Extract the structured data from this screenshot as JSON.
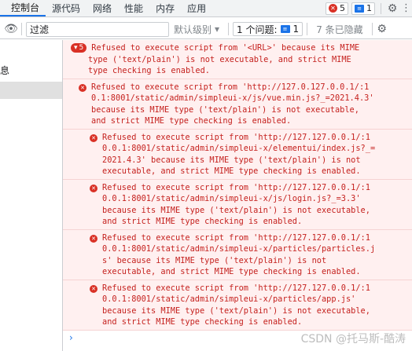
{
  "tabs": [
    "控制台",
    "源代码",
    "网络",
    "性能",
    "内存",
    "应用"
  ],
  "tools": {
    "error_count": "5",
    "message_count": "1"
  },
  "toolbar": {
    "filter_value": "过滤",
    "levels_label": "默认级别",
    "issues_label": "1 个问题:",
    "issues_count": "1",
    "hidden_label": "7 条已隐藏"
  },
  "sidebar": {
    "label": "息"
  },
  "console": {
    "group_count": "5",
    "head_lines": [
      "Refused to execute script from '<URL>' because its MIME",
      "type ('text/plain') is not executable, and strict MIME",
      "type checking is enabled."
    ],
    "first": [
      "Refused to execute script from 'http://127.0.127.0.0.1/:1",
      "0.1:8001/static/admin/simpleui-x/js/vue.min.js?_=2021.4.3'",
      "because its MIME type ('text/plain') is not executable,",
      "and strict MIME type checking is enabled."
    ],
    "items": [
      [
        "Refused to execute script from 'http://127.127.0.0.1/:1",
        "0.0.1:8001/static/admin/simpleui-x/elementui/index.js?_=",
        "2021.4.3' because its MIME type ('text/plain') is not",
        "executable, and strict MIME type checking is enabled."
      ],
      [
        "Refused to execute script from 'http://127.127.0.0.1/:1",
        "0.0.1:8001/static/admin/simpleui-x/js/login.js?_=3.3'",
        "because its MIME type ('text/plain') is not executable,",
        "and strict MIME type checking is enabled."
      ],
      [
        "Refused to execute script from 'http://127.127.0.0.1/:1",
        "0.0.1:8001/static/admin/simpleui-x/particles/particles.j",
        "s' because its MIME type ('text/plain') is not",
        "executable, and strict MIME type checking is enabled."
      ],
      [
        "Refused to execute script from 'http://127.127.0.0.1/:1",
        "0.0.1:8001/static/admin/simpleui-x/particles/app.js'",
        "because its MIME type ('text/plain') is not executable,",
        "and strict MIME type checking is enabled."
      ]
    ],
    "prompt": "›"
  },
  "watermark": "CSDN @托马斯-酷涛",
  "colors": {
    "error_red": "#d93025",
    "error_bg": "#fff0f0",
    "accent_blue": "#1a73e8"
  },
  "icons": [
    "error-icon",
    "message-icon",
    "gear-icon",
    "more-icon",
    "eye-icon",
    "chevron-down-icon",
    "prompt-icon"
  ]
}
